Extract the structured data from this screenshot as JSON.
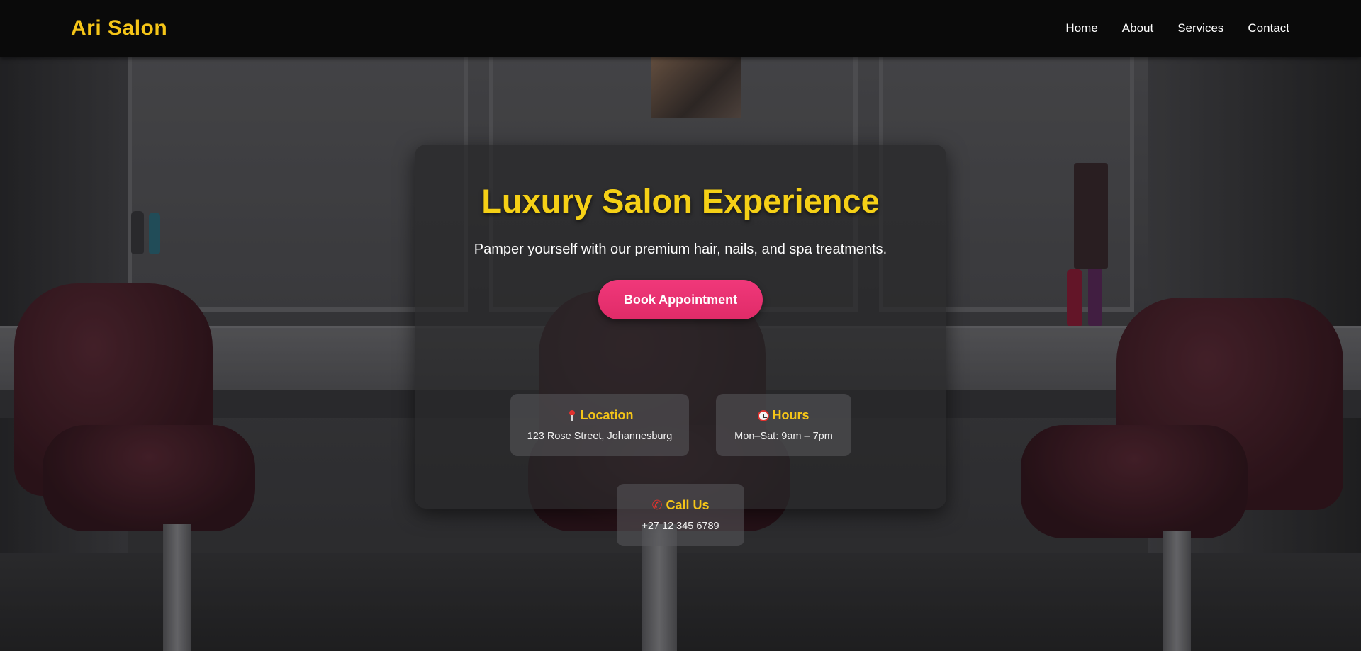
{
  "brand": "Ari Salon",
  "nav": {
    "items": [
      {
        "label": "Home"
      },
      {
        "label": "About"
      },
      {
        "label": "Services"
      },
      {
        "label": "Contact"
      }
    ]
  },
  "hero": {
    "title": "Luxury Salon Experience",
    "subtitle": "Pamper yourself with our premium hair, nails, and spa treatments.",
    "cta_label": "Book Appointment",
    "info": {
      "location": {
        "icon": "pin-icon",
        "title": "Location",
        "text": "123 Rose Street, Johannesburg"
      },
      "hours": {
        "icon": "clock-icon",
        "title": "Hours",
        "text": "Mon–Sat: 9am – 7pm"
      },
      "call": {
        "icon": "phone-icon",
        "title": "Call Us",
        "text": "+27 12 345 6789"
      }
    }
  },
  "colors": {
    "accent": "#f5c518",
    "cta": "#e8306f",
    "navbar": "#0a0a0a"
  }
}
